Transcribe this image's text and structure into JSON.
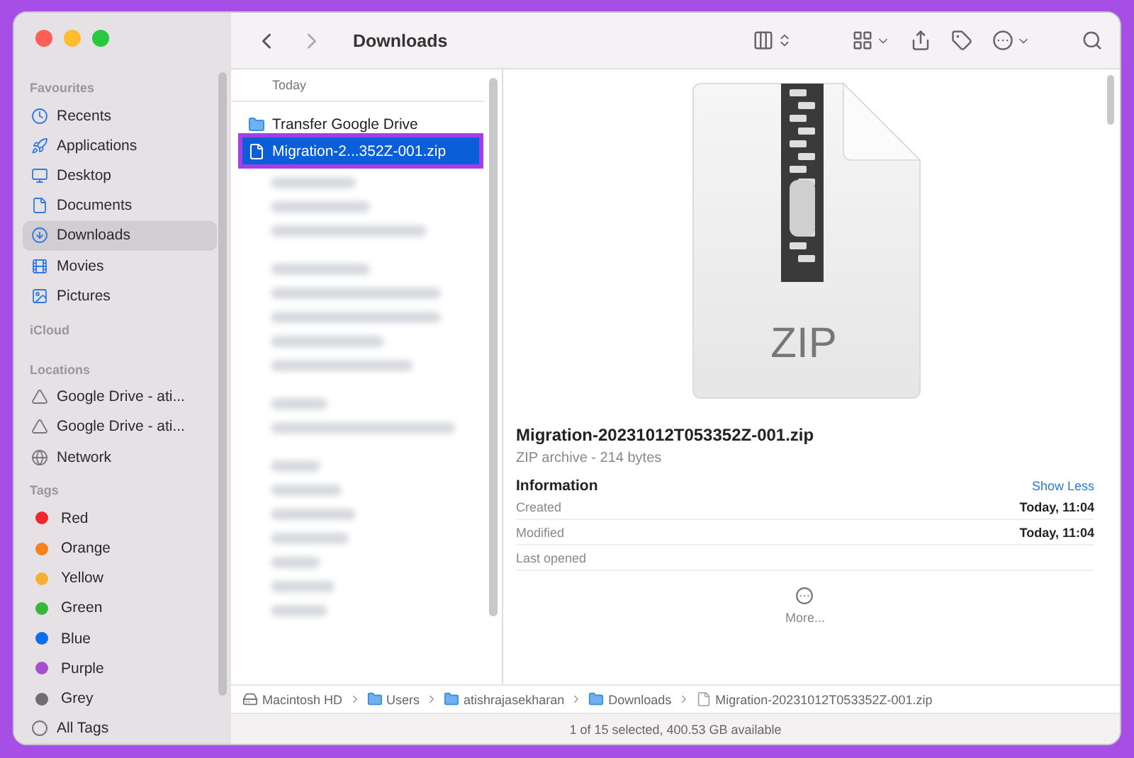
{
  "window": {
    "title": "Downloads"
  },
  "sidebar": {
    "sections": [
      {
        "heading": "Favourites",
        "items": [
          {
            "label": "Recents",
            "selected": false
          },
          {
            "label": "Applications",
            "selected": false
          },
          {
            "label": "Desktop",
            "selected": false
          },
          {
            "label": "Documents",
            "selected": false
          },
          {
            "label": "Downloads",
            "selected": true
          },
          {
            "label": "Movies",
            "selected": false
          },
          {
            "label": "Pictures",
            "selected": false
          }
        ]
      },
      {
        "heading": "iCloud"
      },
      {
        "heading": "Locations",
        "items": [
          {
            "label": "Google Drive - ati...",
            "selected": false
          },
          {
            "label": "Google Drive - ati...",
            "selected": false
          },
          {
            "label": "Network",
            "selected": false
          }
        ]
      },
      {
        "heading": "Tags",
        "items": [
          {
            "label": "Red",
            "color": "#f0282d",
            "selected": false
          },
          {
            "label": "Orange",
            "color": "#f7821b",
            "selected": false
          },
          {
            "label": "Yellow",
            "color": "#f5b02f",
            "selected": false
          },
          {
            "label": "Green",
            "color": "#38b63a",
            "selected": false
          },
          {
            "label": "Blue",
            "color": "#0a6fe8",
            "selected": false
          },
          {
            "label": "Purple",
            "color": "#a550d0",
            "selected": false
          },
          {
            "label": "Grey",
            "color": "#6e6e70",
            "selected": false
          },
          {
            "label": "All Tags",
            "selected": false
          }
        ]
      }
    ]
  },
  "column": {
    "group": "Today",
    "items": [
      {
        "label": "Transfer Google Drive",
        "kind": "folder",
        "selected": false
      },
      {
        "label": "Migration-2...352Z-001.zip",
        "kind": "file",
        "selected": true
      }
    ]
  },
  "preview": {
    "icon_label": "ZIP",
    "name": "Migration-20231012T053352Z-001.zip",
    "subtitle": "ZIP archive - 214 bytes",
    "info_heading": "Information",
    "toggle": "Show Less",
    "rows": [
      {
        "label": "Created",
        "value": "Today, 11:04"
      },
      {
        "label": "Modified",
        "value": "Today, 11:04"
      },
      {
        "label": "Last opened"
      }
    ],
    "more": "More..."
  },
  "path_bar": [
    {
      "label": "Macintosh HD",
      "kind": "disk"
    },
    {
      "label": "Users",
      "kind": "folder"
    },
    {
      "label": "atishrajasekharan",
      "kind": "folder"
    },
    {
      "label": "Downloads",
      "kind": "folder"
    },
    {
      "label": "Migration-20231012T053352Z-001.zip",
      "kind": "file"
    }
  ],
  "status_bar": "1 of 15 selected, 400.53 GB available"
}
